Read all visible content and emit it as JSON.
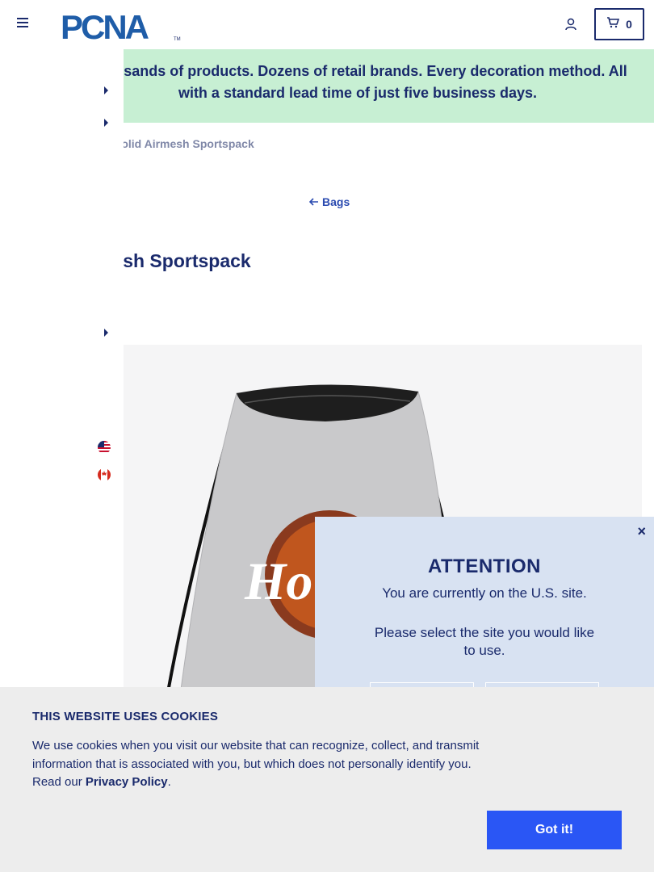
{
  "header": {
    "logo_text": "PCNA",
    "logo_tm": "TM",
    "cart_count": "0"
  },
  "banner": {
    "text": "Thousands of products. Dozens of retail brands. Every decoration method. All with a standard lead time of just five business days."
  },
  "breadcrumb": {
    "current": "Solid Airmesh Sportspack"
  },
  "back_link": {
    "label": "Bags"
  },
  "product": {
    "title": "Airmesh Sportspack",
    "imprint_text": "Ho"
  },
  "attention": {
    "title": "ATTENTION",
    "line1": "You are currently on the U.S. site.",
    "line2": "Please select the site you would like to use.",
    "close": "×"
  },
  "cookie": {
    "title": "THIS WEBSITE USES COOKIES",
    "text": "We use cookies when you visit our website that can recognize, collect, and transmit information that is associated with you, but which does not personally identify you. Read our ",
    "link": "Privacy Policy",
    "tail": ".",
    "button": "Got it!"
  },
  "colors": {
    "navy": "#1a2a6c",
    "brand_blue": "#1f5da8",
    "banner_green": "#c7efd3",
    "popup_bg": "#d8e2f2",
    "cookie_bg": "#ededed",
    "button_blue": "#2a56f5"
  },
  "icons": {
    "menu": "hamburger-icon",
    "account": "user-icon",
    "cart": "cart-icon",
    "back": "arrow-left-icon",
    "flag_us": "us-flag-icon",
    "flag_ca": "canada-flag-icon"
  }
}
